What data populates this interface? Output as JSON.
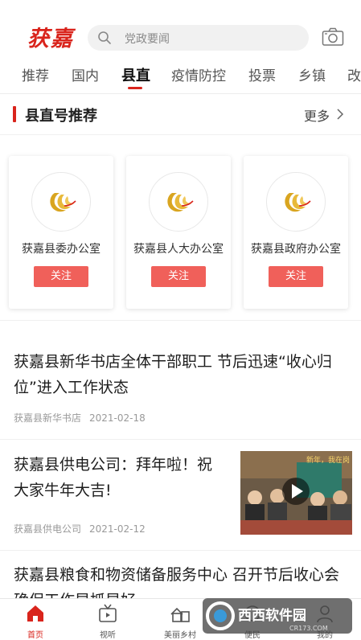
{
  "header": {
    "logo_text": "获嘉",
    "search_placeholder": "党政要闻"
  },
  "tabs": [
    {
      "label": "推荐"
    },
    {
      "label": "国内"
    },
    {
      "label": "县直",
      "active": true
    },
    {
      "label": "疫情防控"
    },
    {
      "label": "投票"
    },
    {
      "label": "乡镇"
    },
    {
      "label": "改"
    }
  ],
  "section": {
    "title": "县直号推荐",
    "more_label": "更多"
  },
  "cards": [
    {
      "name": "获嘉县委办公室",
      "follow_label": "关注"
    },
    {
      "name": "获嘉县人大办公室",
      "follow_label": "关注"
    },
    {
      "name": "获嘉县政府办公室",
      "follow_label": "关注"
    }
  ],
  "articles": [
    {
      "title": "获嘉县新华书店全体干部职工 节后迅速“收心归位”进入工作状态",
      "source": "获嘉县新华书店",
      "date": "2021-02-18"
    },
    {
      "title": "获嘉县供电公司：拜年啦！祝大家牛年大吉!",
      "source": "获嘉县供电公司",
      "date": "2021-02-12",
      "thumb_caption": "新年，我在岗"
    },
    {
      "title": "获嘉县粮食和物资储备服务中心 召开节后收心会确保工作早抓早好",
      "source": "",
      "date": ""
    }
  ],
  "bottom_nav": [
    {
      "label": "首页",
      "icon": "home-icon",
      "active": true
    },
    {
      "label": "视听",
      "icon": "tv-icon"
    },
    {
      "label": "美丽乡村",
      "icon": "village-icon"
    },
    {
      "label": "便民",
      "icon": "service-icon"
    },
    {
      "label": "我的",
      "icon": "user-icon"
    }
  ],
  "watermark": {
    "brand": "西西软件园",
    "domain": "CR173.COM"
  },
  "colors": {
    "accent": "#d9241c",
    "follow_button": "#f0605a",
    "logo_gold": "#d9a520"
  }
}
